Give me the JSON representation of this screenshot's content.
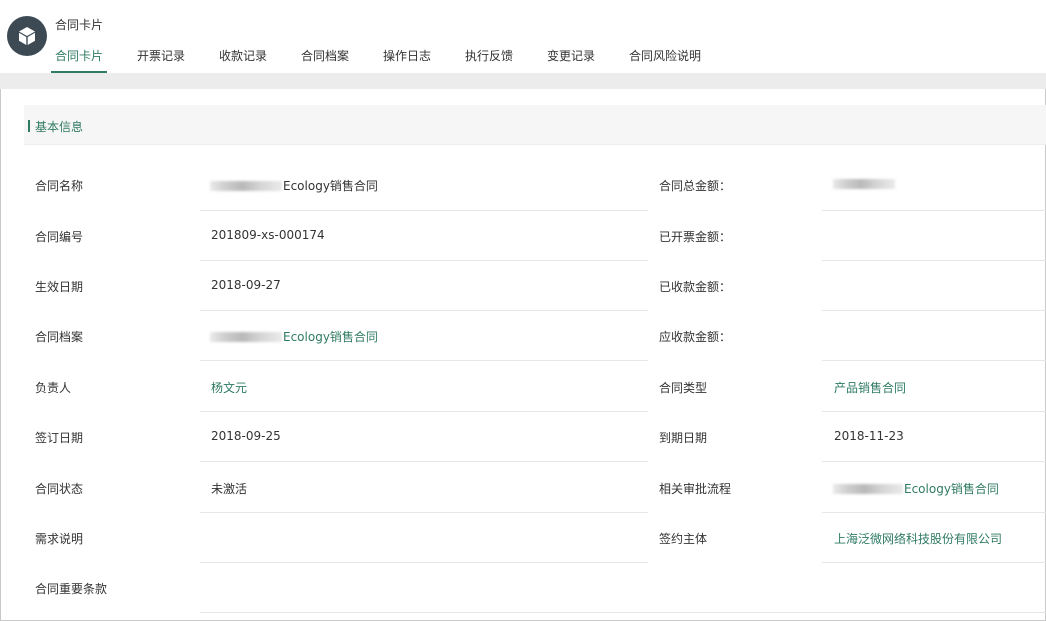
{
  "header": {
    "app_title": "合同卡片",
    "icon": "cube-icon",
    "accent_color": "#2f7a63"
  },
  "tabs": [
    {
      "label": "合同卡片",
      "active": true
    },
    {
      "label": "开票记录",
      "active": false
    },
    {
      "label": "收款记录",
      "active": false
    },
    {
      "label": "合同档案",
      "active": false
    },
    {
      "label": "操作日志",
      "active": false
    },
    {
      "label": "执行反馈",
      "active": false
    },
    {
      "label": "变更记录",
      "active": false
    },
    {
      "label": "合同风险说明",
      "active": false
    }
  ],
  "section": {
    "title": "基本信息"
  },
  "fields_left": [
    {
      "label": "合同名称",
      "value": "Ecology销售合同",
      "redacted_prefix": true,
      "link": false
    },
    {
      "label": "合同编号",
      "value": "201809-xs-000174",
      "link": false
    },
    {
      "label": "生效日期",
      "value": "2018-09-27",
      "link": false
    },
    {
      "label": "合同档案",
      "value": "Ecology销售合同",
      "redacted_prefix": true,
      "link": true
    },
    {
      "label": "负责人",
      "value": "杨文元",
      "link": true
    },
    {
      "label": "签订日期",
      "value": "2018-09-25",
      "link": false
    },
    {
      "label": "合同状态",
      "value": "未激活",
      "link": false
    },
    {
      "label": "需求说明",
      "value": "",
      "link": false
    },
    {
      "label": "合同重要条款",
      "value": "",
      "link": false
    }
  ],
  "fields_right": [
    {
      "label": "合同总金额：",
      "value": "",
      "redacted": true
    },
    {
      "label": "已开票金额：",
      "value": ""
    },
    {
      "label": "已收款金额：",
      "value": ""
    },
    {
      "label": "应收款金额：",
      "value": ""
    },
    {
      "label": "合同类型",
      "value": "产品销售合同",
      "link": true
    },
    {
      "label": "到期日期",
      "value": "2018-11-23",
      "link": false
    },
    {
      "label": "相关审批流程",
      "value": "Ecology销售合同",
      "redacted_prefix": true,
      "link": true
    },
    {
      "label": "签约主体",
      "value": "上海泛微网络科技股份有限公司",
      "link": true
    }
  ]
}
